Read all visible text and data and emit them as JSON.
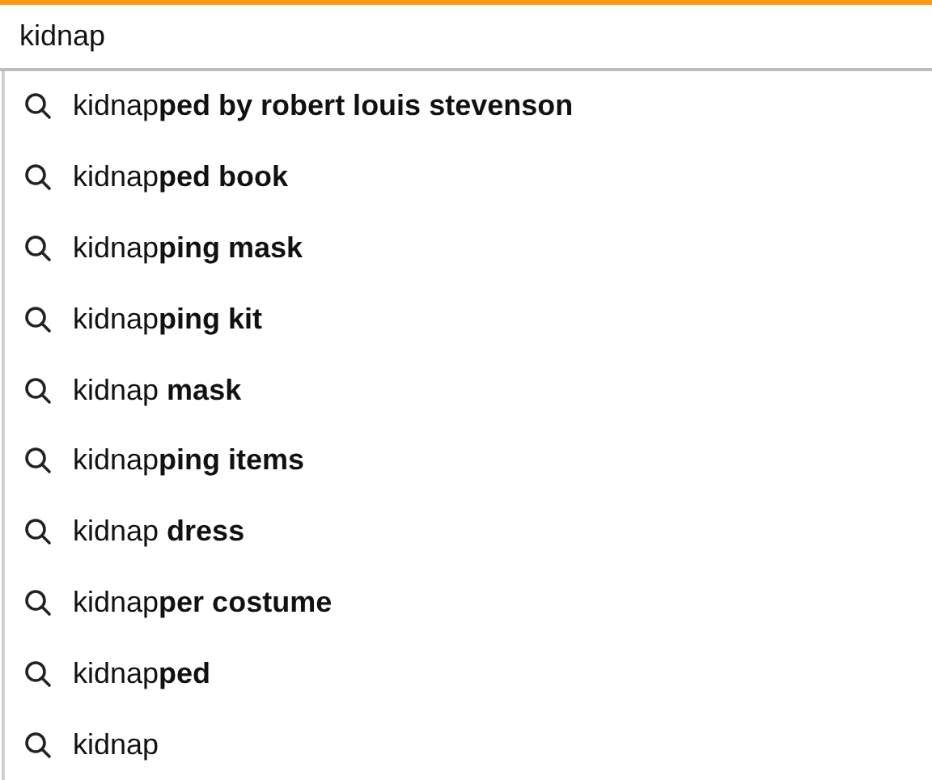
{
  "search": {
    "value": "kidnap"
  },
  "suggestions": [
    {
      "text": "kidnap**ped by robert louis stevenson**"
    },
    {
      "text": "kidnap**ped book**"
    },
    {
      "text": "kidnap**ping mask**"
    },
    {
      "text": "kidnap**ping kit**"
    },
    {
      "text": "kidnap **mask**"
    },
    {
      "text": "kidnap**ping items**"
    },
    {
      "text": "kidnap **dress**"
    },
    {
      "text": "kidnap**per costume**"
    },
    {
      "text": "kidnap**ped**"
    },
    {
      "text": "kidnap"
    }
  ]
}
